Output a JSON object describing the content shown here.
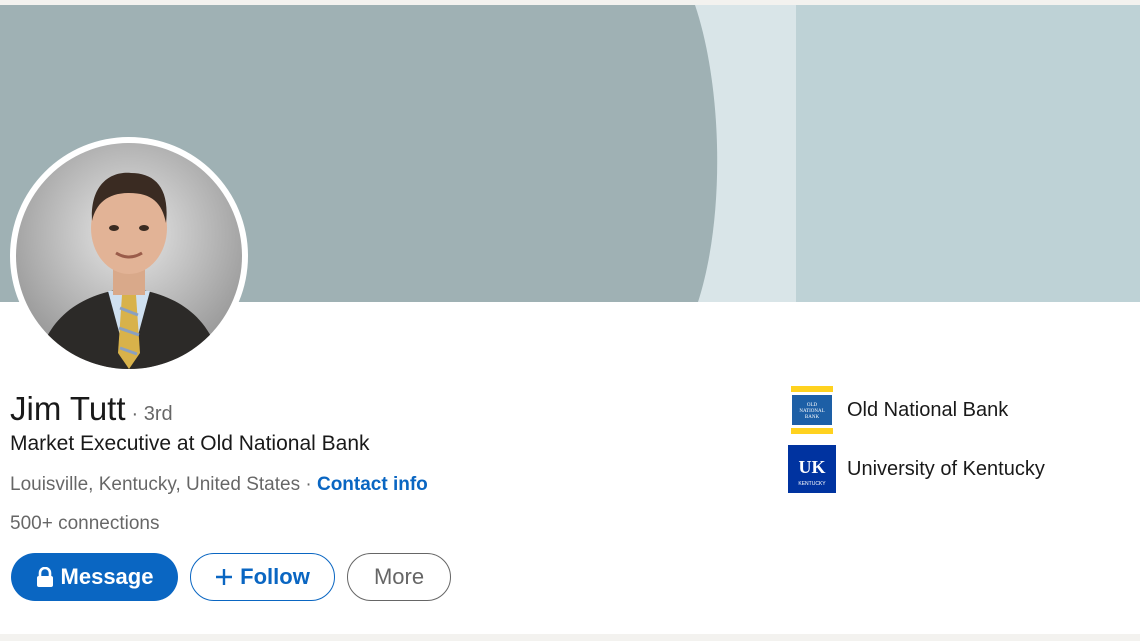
{
  "profile": {
    "name": "Jim Tutt",
    "degree": "· 3rd",
    "headline": "Market Executive at Old National Bank",
    "location": "Louisville, Kentucky, United States",
    "separator": "·",
    "contact_label": "Contact info",
    "connections": "500+ connections"
  },
  "actions": {
    "message_label": "Message",
    "follow_label": "Follow",
    "more_label": "More"
  },
  "organizations": [
    {
      "name": "Old National Bank",
      "logo_text": "OLD NATIONAL BANK",
      "icon": "old-national-bank-logo"
    },
    {
      "name": "University of Kentucky",
      "logo_text": "UK",
      "logo_subtext": "KENTUCKY",
      "icon": "university-of-kentucky-logo"
    }
  ],
  "colors": {
    "accent": "#0a66c2",
    "banner": "#9fb1b4",
    "banner_light": "#bed2d6"
  }
}
